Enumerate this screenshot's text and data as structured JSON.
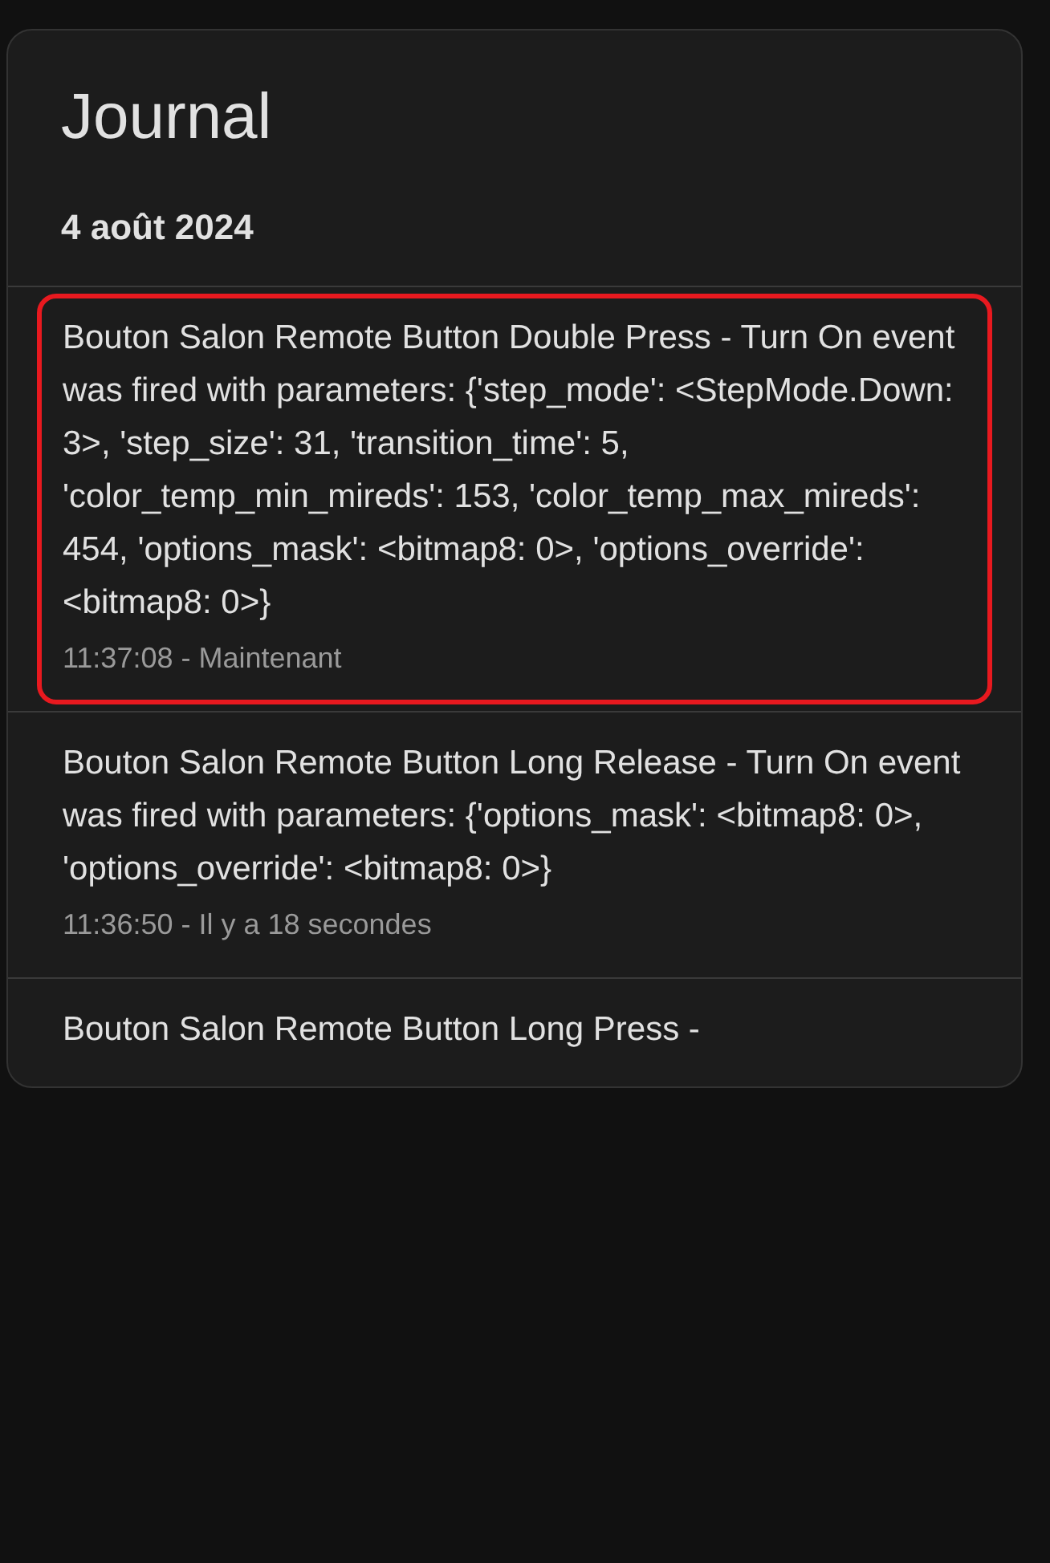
{
  "card": {
    "title": "Journal",
    "date": "4 août 2024"
  },
  "entries": [
    {
      "message": "Bouton Salon Remote Button Double Press - Turn On event was fired with parameters: {'step_mode': <StepMode.Down: 3>, 'step_size': 31, 'transition_time': 5, 'color_temp_min_mireds': 153, 'color_temp_max_mireds': 454, 'options_mask': <bitmap8: 0>, 'options_override': <bitmap8: 0>}",
      "time": "11:37:08 - Maintenant",
      "highlighted": true
    },
    {
      "message": "Bouton Salon Remote Button Long Release - Turn On event was fired with parameters: {'options_mask': <bitmap8: 0>, 'options_override': <bitmap8: 0>}",
      "time": "11:36:50 - Il y a 18 secondes",
      "highlighted": false
    },
    {
      "message": "Bouton Salon Remote Button Long Press -",
      "highlighted": false
    }
  ]
}
